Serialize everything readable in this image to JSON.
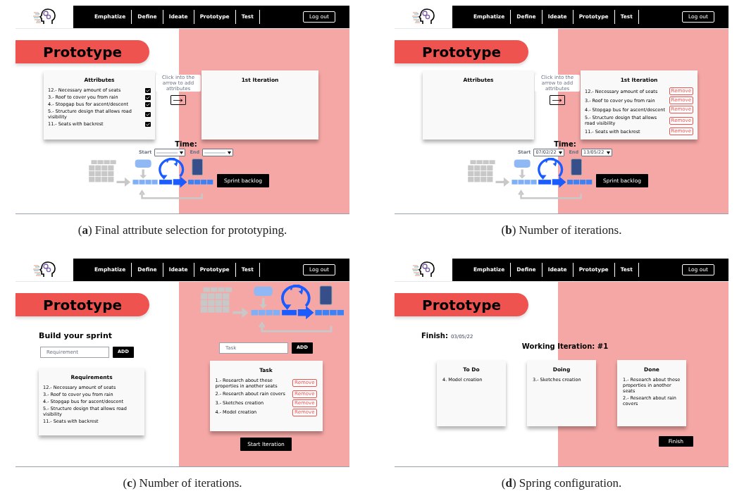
{
  "panels": [
    {
      "kind": "selection",
      "caption": "(**a**) Final attribute selection for prototyping.",
      "nav": [
        "Emphatize",
        "Define",
        "Ideate",
        "Prototype",
        "Test"
      ],
      "logout": "Log out",
      "title": "Prototype",
      "attributes": {
        "title": "Attributes",
        "items": [
          {
            "text": "12.- Necessary amount of seats",
            "checked": true
          },
          {
            "text": "3.- Roof to cover you from rain",
            "checked": true
          },
          {
            "text": "4.- Stopgap bus for ascent/descent",
            "checked": true
          },
          {
            "text": "5.- Structure design that allows road visibility",
            "checked": true
          },
          {
            "text": "11.- Seats with backrest",
            "checked": true
          }
        ]
      },
      "hint": "Click into the arrow to add attributes",
      "iteration": {
        "title": "1st Iteration"
      },
      "time": {
        "label": "Time:",
        "start_label": "Start",
        "end_label": "End"
      },
      "backlog_button": "Sprint backlog"
    },
    {
      "kind": "selection",
      "caption": "(**b**) Number of iterations.",
      "nav": [
        "Emphatize",
        "Define",
        "Ideate",
        "Prototype",
        "Test"
      ],
      "logout": "Log out",
      "title": "Prototype",
      "attributes": {
        "title": "Attributes"
      },
      "hint": "Click into the arrow to add attributes",
      "iteration": {
        "title": "1st Iteration",
        "items": [
          {
            "text": "12.- Necessary amount of seats",
            "remove": "Remove"
          },
          {
            "text": "3.- Roof to cover you from rain",
            "remove": "Remove"
          },
          {
            "text": "4.- Stopgap bus for ascent/descent",
            "remove": "Remove"
          },
          {
            "text": "5.- Structure design that allows road visibility",
            "remove": "Remove"
          },
          {
            "text": "11.- Seats with backrest",
            "remove": "Remove"
          }
        ]
      },
      "time": {
        "label": "Time:",
        "start_label": "Start",
        "start": "07/02/22",
        "end_label": "End",
        "end": "13/05/22"
      },
      "backlog_button": "Sprint backlog"
    },
    {
      "kind": "build",
      "caption": "(**c**) Number of iterations.",
      "nav": [
        "Emphatize",
        "Define",
        "Ideate",
        "Prototype",
        "Test"
      ],
      "logout": "Log out",
      "title": "Prototype",
      "heading": "Build your sprint",
      "requirement_placeholder": "Requirement",
      "add": "ADD",
      "requirements": {
        "title": "Requirements",
        "items": [
          "12.- Necessary amount of seats",
          "3.- Roof to cover you from rain",
          "4.- Stopgap bus for ascent/descent",
          "5.- Structure design that allows road visibility",
          "11.- Seats with backrest"
        ]
      },
      "task_placeholder": "Task",
      "task_add": "ADD",
      "tasks": {
        "title": "Task",
        "items": [
          {
            "text": "1.- Research about these properties in another seats",
            "remove": "Remove"
          },
          {
            "text": "2.- Research about rain covers",
            "remove": "Remove"
          },
          {
            "text": "3.- Sketches creation",
            "remove": "Remove"
          },
          {
            "text": "4.- Model creation",
            "remove": "Remove"
          }
        ]
      },
      "start_button": "Start Iteration"
    },
    {
      "kind": "board",
      "caption": "(**d**) Spring configuration.",
      "nav": [
        "Emphatize",
        "Define",
        "Ideate",
        "Prototype",
        "Test"
      ],
      "logout": "Log out",
      "title": "Prototype",
      "finish_label": "Finish:",
      "finish_date": "03/05/22",
      "working": "Working Iteration: #1",
      "columns": [
        {
          "title": "To Do",
          "items": [
            "4. Model creation"
          ]
        },
        {
          "title": "Doing",
          "items": [
            "3.- Sketches creation"
          ]
        },
        {
          "title": "Done",
          "items": [
            "1.- Research about these properties in another seats",
            "2.- Research about rain covers"
          ]
        }
      ],
      "finish_button": "Finish"
    }
  ]
}
